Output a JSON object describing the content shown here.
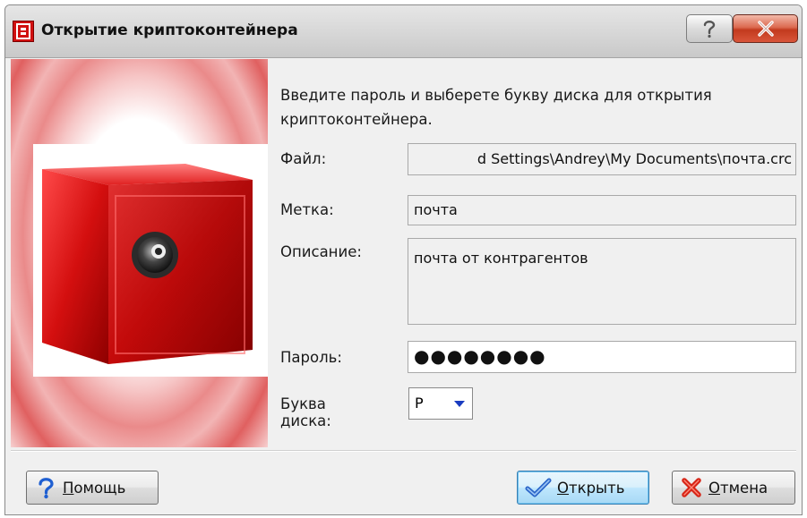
{
  "window": {
    "title": "Открытие криптоконтейнера",
    "help_glyph": "?",
    "close_glyph": "X"
  },
  "intro_text": "Введите пароль и выберете букву диска для открытия криптоконтейнера.",
  "fields": {
    "file_label": "Файл:",
    "file_value": "d Settings\\Andrey\\My Documents\\почта.crc",
    "tag_label": "Метка:",
    "tag_value": "почта",
    "description_label": "Описание:",
    "description_value": "почта от контрагентов",
    "password_label": "Пароль:",
    "password_value": "●●●●●●●●",
    "drive_label": "Буква диска:",
    "drive_value": "P"
  },
  "buttons": {
    "help_first": "П",
    "help_rest": "омощь",
    "open_first": "О",
    "open_rest": "ткрыть",
    "cancel_first": "О",
    "cancel_rest": "тмена"
  },
  "colors": {
    "accent_red": "#d11010",
    "focus_blue": "#3c7fb1"
  }
}
